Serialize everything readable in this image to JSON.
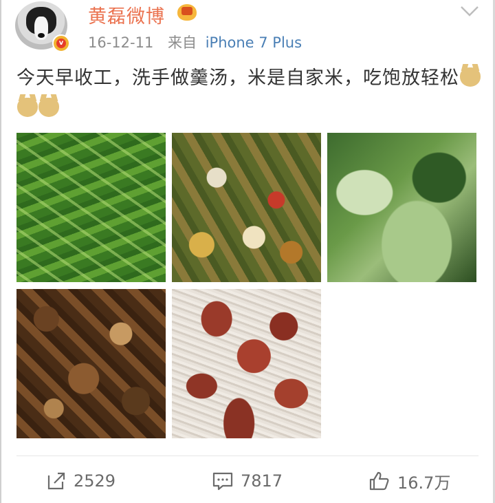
{
  "post": {
    "author": "黄磊微博",
    "date": "16-12-11",
    "source_prefix": "来自",
    "device": "iPhone 7 Plus",
    "text": "今天早收工，洗手做羹汤，米是自家米，吃饱放轻松"
  },
  "photos": [
    {
      "name": "stir-fried-greens"
    },
    {
      "name": "stir-fried-peppers"
    },
    {
      "name": "bok-choy"
    },
    {
      "name": "braised-dish"
    },
    {
      "name": "sausage-rice"
    }
  ],
  "actions": {
    "forward_count": "2529",
    "comment_count": "7817",
    "like_count": "16.7万"
  },
  "colors": {
    "username": "#eb7350",
    "device_link": "#4a7fb5",
    "meta": "#8c8c8c",
    "text": "#333333"
  },
  "icons": [
    "avatar",
    "verified-badge-icon",
    "vip-crown-icon",
    "chevron-down-icon",
    "doge-emoji-icon",
    "forward-icon",
    "comment-icon",
    "like-icon"
  ]
}
